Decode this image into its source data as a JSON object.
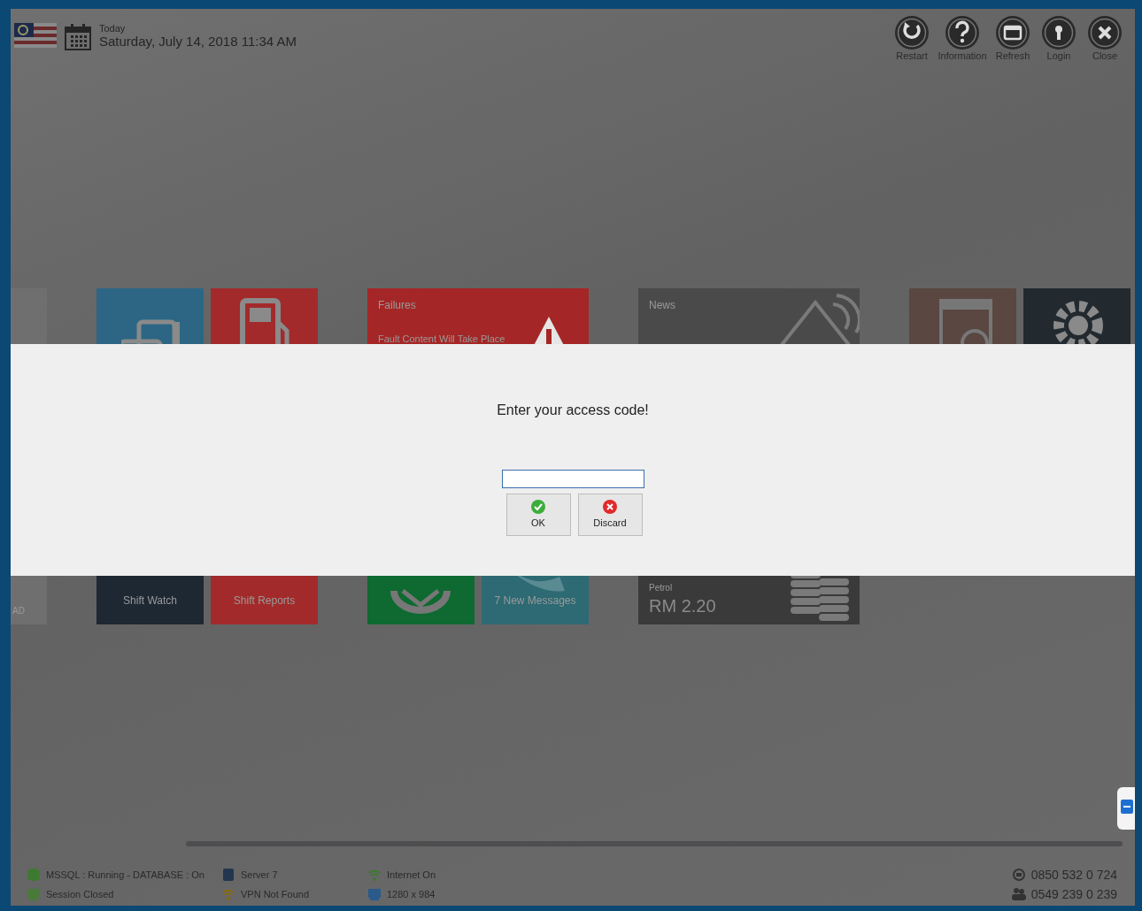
{
  "header": {
    "date_caption": "Today",
    "date": "Saturday, July 14, 2018 11:34 AM"
  },
  "toolbar": [
    {
      "label": "Restart"
    },
    {
      "label": "Information"
    },
    {
      "label": "Refresh"
    },
    {
      "label": "Login"
    },
    {
      "label": "Close"
    }
  ],
  "tile_groups": [
    {
      "tiles": [
        {
          "kind": "tall",
          "color": "#6f6f6f",
          "label": "AD"
        }
      ]
    },
    {
      "tiles": [
        {
          "kind": "icon",
          "color": "#2c6684"
        },
        {
          "kind": "icon",
          "color": "#a32a2a"
        },
        {
          "kind": "label",
          "color": "#1e2833",
          "label": "Shift Watch"
        },
        {
          "kind": "label",
          "color": "#a32a2a",
          "label": "Shift Reports"
        }
      ]
    },
    {
      "tiles": [
        {
          "kind": "alert",
          "color": "#a52626",
          "title": "Failures",
          "text": "Fault Content Will Take Place"
        },
        {
          "kind": "icon",
          "color": "#0e6a30"
        },
        {
          "kind": "label",
          "color": "#2d6a73",
          "label": "7 New Messages"
        }
      ]
    },
    {
      "tiles": [
        {
          "kind": "news",
          "color": "#4a4a4a",
          "title": "News"
        },
        {
          "kind": "price",
          "color": "#3a3a3a",
          "title": "Petrol",
          "value": "RM 2.20"
        }
      ]
    },
    {
      "tiles": [
        {
          "kind": "icon",
          "color": "#5a4742"
        },
        {
          "kind": "icon",
          "color": "#222a30"
        }
      ]
    }
  ],
  "dialog": {
    "prompt": "Enter your access code!",
    "buttons": [
      {
        "label": "OK",
        "kind": "ok"
      },
      {
        "label": "Discard",
        "kind": "discard"
      }
    ]
  },
  "status_bar": [
    {
      "text": "MSSQL : Running - DATABASE : On"
    },
    {
      "text": "Session Closed"
    },
    {
      "text": "Server 7"
    },
    {
      "text": "VPN Not Found"
    },
    {
      "text": "Internet On"
    },
    {
      "text": "1280 x 984"
    }
  ],
  "phones": [
    {
      "text": "0850 532 0 724"
    },
    {
      "text": "0549 239 0 239"
    }
  ]
}
